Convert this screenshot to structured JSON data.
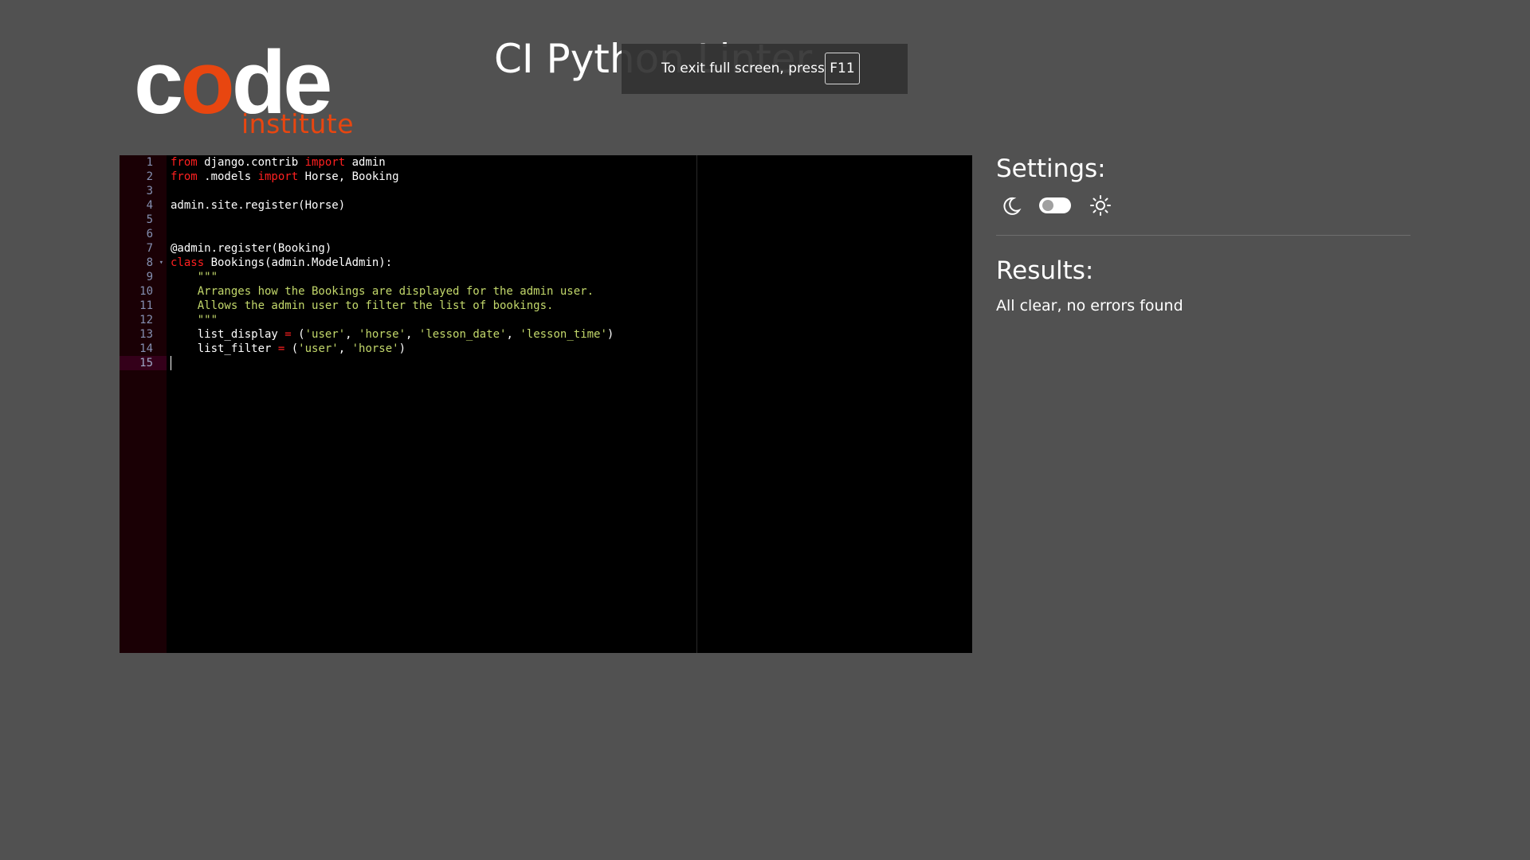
{
  "header": {
    "logo_code_pre": "c",
    "logo_code_o": "o",
    "logo_code_post": "de",
    "logo_institute": "institute",
    "app_title": "CI Python Linter"
  },
  "fullscreen_notice": {
    "text": "To exit full screen, press",
    "key": "F11"
  },
  "editor": {
    "line_numbers": [
      "1",
      "2",
      "3",
      "4",
      "5",
      "6",
      "7",
      "8",
      "9",
      "10",
      "11",
      "12",
      "13",
      "14",
      "15"
    ],
    "active_line": "15",
    "fold_marker_line": "8",
    "lines": [
      [
        {
          "t": "from",
          "c": "kw"
        },
        {
          "t": " django.contrib ",
          "c": ""
        },
        {
          "t": "import",
          "c": "kw"
        },
        {
          "t": " admin",
          "c": ""
        }
      ],
      [
        {
          "t": "from",
          "c": "kw"
        },
        {
          "t": " .models ",
          "c": ""
        },
        {
          "t": "import",
          "c": "kw"
        },
        {
          "t": " Horse, Booking",
          "c": ""
        }
      ],
      [],
      [
        {
          "t": "admin.site.register(Horse)",
          "c": ""
        }
      ],
      [],
      [],
      [
        {
          "t": "@admin.register(Booking)",
          "c": ""
        }
      ],
      [
        {
          "t": "class",
          "c": "kw"
        },
        {
          "t": " Bookings(admin.ModelAdmin):",
          "c": ""
        }
      ],
      [
        {
          "t": "    \"\"\"",
          "c": "doc"
        }
      ],
      [
        {
          "t": "    Arranges how the Bookings are displayed for the admin user.",
          "c": "doc"
        }
      ],
      [
        {
          "t": "    Allows the admin user to filter the list of bookings.",
          "c": "doc"
        }
      ],
      [
        {
          "t": "    \"\"\"",
          "c": "doc"
        }
      ],
      [
        {
          "t": "    list_display ",
          "c": ""
        },
        {
          "t": "=",
          "c": "op"
        },
        {
          "t": " (",
          "c": ""
        },
        {
          "t": "'user'",
          "c": "str"
        },
        {
          "t": ", ",
          "c": ""
        },
        {
          "t": "'horse'",
          "c": "str"
        },
        {
          "t": ", ",
          "c": ""
        },
        {
          "t": "'lesson_date'",
          "c": "str"
        },
        {
          "t": ", ",
          "c": ""
        },
        {
          "t": "'lesson_time'",
          "c": "str"
        },
        {
          "t": ")",
          "c": ""
        }
      ],
      [
        {
          "t": "    list_filter ",
          "c": ""
        },
        {
          "t": "=",
          "c": "op"
        },
        {
          "t": " (",
          "c": ""
        },
        {
          "t": "'user'",
          "c": "str"
        },
        {
          "t": ", ",
          "c": ""
        },
        {
          "t": "'horse'",
          "c": "str"
        },
        {
          "t": ")",
          "c": ""
        }
      ],
      []
    ]
  },
  "settings": {
    "title": "Settings:",
    "moon_icon": "moon-icon",
    "sun_icon": "sun-icon",
    "theme_toggle_state": "dark"
  },
  "results": {
    "title": "Results:",
    "message": "All clear, no errors found"
  }
}
